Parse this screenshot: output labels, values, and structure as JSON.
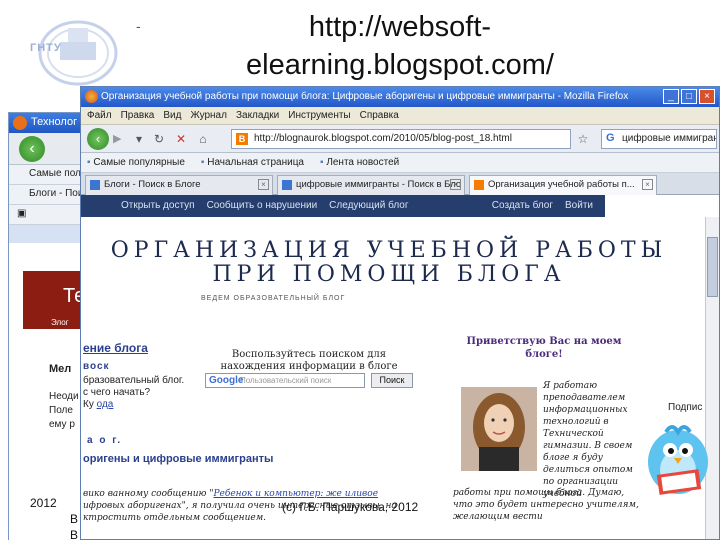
{
  "slide": {
    "title": "http://websoft-elearning.blogspot.com/",
    "dash": "-",
    "logo_text": "ГНТУ",
    "footer_left": "2012",
    "footer_center": "(c) Г.Б. Паршукова, 2012",
    "bottom_letters": [
      "В",
      "В"
    ]
  },
  "bg_browser": {
    "title": "Технолог",
    "bookmarks": "Самые пол",
    "tab": "Блоги - Поис",
    "page_title": "Те",
    "page_sub": "Элог",
    "lines": [
      "Мел",
      "Неоди",
      "Поле",
      "ему р"
    ]
  },
  "browser": {
    "title": "Организация учебной работы при помощи блога: Цифровые аборигены и цифровые иммигранты - Mozilla Firefox",
    "menu": [
      "Файл",
      "Правка",
      "Вид",
      "Журнал",
      "Закладки",
      "Инструменты",
      "Справка"
    ],
    "url": "http://blognaurok.blogspot.com/2010/05/blog-post_18.html",
    "search_value": "цифровые иммигрант",
    "bookmarks": [
      "Самые популярные",
      "Начальная страница",
      "Лента новостей"
    ],
    "tabs": [
      {
        "label": "Блоги - Поиск в Блоге",
        "active": false
      },
      {
        "label": "цифровые иммигранты - Поиск в Бло",
        "active": false
      },
      {
        "label": "Организация учебной работы п...",
        "active": true
      }
    ],
    "blogger_bar": {
      "left": [
        "Открыть доступ",
        "Сообщить о нарушении",
        "Следующий блог"
      ],
      "right": [
        "Создать блог",
        "Войти"
      ]
    }
  },
  "blog": {
    "title": "ОРГАНИЗАЦИЯ УЧЕБНОЙ РАБОТЫ ПРИ ПОМОЩИ БЛОГА",
    "subtitle": "ВЕДЕМ ОБРАЗОВАТЕЛЬНЫЙ БЛОГ",
    "section_head": "ение блога",
    "left_lines": [
      "воск",
      "бразовательный блог.",
      "с чего начать?",
      "Ку ",
      "ода"
    ],
    "search_label": "Воспользуйтесь поиском для нахождения информации в блоге",
    "search_placeholder": "Пользовательский поиск",
    "search_button": "Поиск",
    "date_line": "а  о  г.",
    "post_title": "оригены и цифровые иммигранты",
    "post_lines": [
      "вико ванному сообщению \"",
      "Ребенок и компьютер: же иливое",
      "ифровых аборигенах\", я получила очень интересные отзывы, на",
      "ктростить отдельным сообщением."
    ],
    "welcome": "Приветствую Вас на моем блоге!",
    "description": "Я работаю преподавателем информационных технологий в Технической гимназии. В своем блоге я буду делиться опытом по организации учебной",
    "description2": "работы при помощи блога. Думаю, что это будет интересно учителям, желающим вести",
    "side_label": "Подпис"
  }
}
